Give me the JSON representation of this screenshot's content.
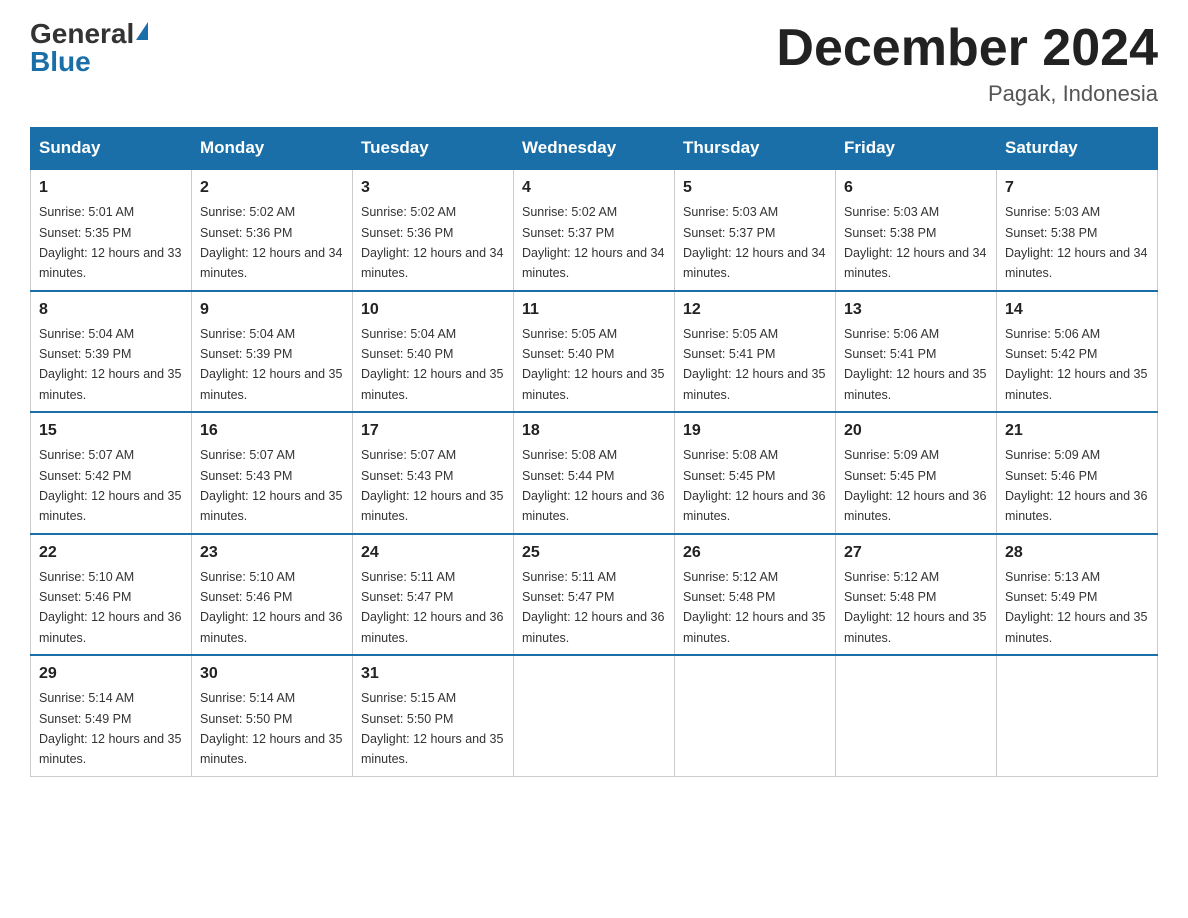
{
  "logo": {
    "general": "General",
    "blue": "Blue",
    "triangle": "▶"
  },
  "title": "December 2024",
  "location": "Pagak, Indonesia",
  "days_of_week": [
    "Sunday",
    "Monday",
    "Tuesday",
    "Wednesday",
    "Thursday",
    "Friday",
    "Saturday"
  ],
  "weeks": [
    [
      {
        "day": 1,
        "sunrise": "5:01 AM",
        "sunset": "5:35 PM",
        "daylight": "12 hours and 33 minutes."
      },
      {
        "day": 2,
        "sunrise": "5:02 AM",
        "sunset": "5:36 PM",
        "daylight": "12 hours and 34 minutes."
      },
      {
        "day": 3,
        "sunrise": "5:02 AM",
        "sunset": "5:36 PM",
        "daylight": "12 hours and 34 minutes."
      },
      {
        "day": 4,
        "sunrise": "5:02 AM",
        "sunset": "5:37 PM",
        "daylight": "12 hours and 34 minutes."
      },
      {
        "day": 5,
        "sunrise": "5:03 AM",
        "sunset": "5:37 PM",
        "daylight": "12 hours and 34 minutes."
      },
      {
        "day": 6,
        "sunrise": "5:03 AM",
        "sunset": "5:38 PM",
        "daylight": "12 hours and 34 minutes."
      },
      {
        "day": 7,
        "sunrise": "5:03 AM",
        "sunset": "5:38 PM",
        "daylight": "12 hours and 34 minutes."
      }
    ],
    [
      {
        "day": 8,
        "sunrise": "5:04 AM",
        "sunset": "5:39 PM",
        "daylight": "12 hours and 35 minutes."
      },
      {
        "day": 9,
        "sunrise": "5:04 AM",
        "sunset": "5:39 PM",
        "daylight": "12 hours and 35 minutes."
      },
      {
        "day": 10,
        "sunrise": "5:04 AM",
        "sunset": "5:40 PM",
        "daylight": "12 hours and 35 minutes."
      },
      {
        "day": 11,
        "sunrise": "5:05 AM",
        "sunset": "5:40 PM",
        "daylight": "12 hours and 35 minutes."
      },
      {
        "day": 12,
        "sunrise": "5:05 AM",
        "sunset": "5:41 PM",
        "daylight": "12 hours and 35 minutes."
      },
      {
        "day": 13,
        "sunrise": "5:06 AM",
        "sunset": "5:41 PM",
        "daylight": "12 hours and 35 minutes."
      },
      {
        "day": 14,
        "sunrise": "5:06 AM",
        "sunset": "5:42 PM",
        "daylight": "12 hours and 35 minutes."
      }
    ],
    [
      {
        "day": 15,
        "sunrise": "5:07 AM",
        "sunset": "5:42 PM",
        "daylight": "12 hours and 35 minutes."
      },
      {
        "day": 16,
        "sunrise": "5:07 AM",
        "sunset": "5:43 PM",
        "daylight": "12 hours and 35 minutes."
      },
      {
        "day": 17,
        "sunrise": "5:07 AM",
        "sunset": "5:43 PM",
        "daylight": "12 hours and 35 minutes."
      },
      {
        "day": 18,
        "sunrise": "5:08 AM",
        "sunset": "5:44 PM",
        "daylight": "12 hours and 36 minutes."
      },
      {
        "day": 19,
        "sunrise": "5:08 AM",
        "sunset": "5:45 PM",
        "daylight": "12 hours and 36 minutes."
      },
      {
        "day": 20,
        "sunrise": "5:09 AM",
        "sunset": "5:45 PM",
        "daylight": "12 hours and 36 minutes."
      },
      {
        "day": 21,
        "sunrise": "5:09 AM",
        "sunset": "5:46 PM",
        "daylight": "12 hours and 36 minutes."
      }
    ],
    [
      {
        "day": 22,
        "sunrise": "5:10 AM",
        "sunset": "5:46 PM",
        "daylight": "12 hours and 36 minutes."
      },
      {
        "day": 23,
        "sunrise": "5:10 AM",
        "sunset": "5:46 PM",
        "daylight": "12 hours and 36 minutes."
      },
      {
        "day": 24,
        "sunrise": "5:11 AM",
        "sunset": "5:47 PM",
        "daylight": "12 hours and 36 minutes."
      },
      {
        "day": 25,
        "sunrise": "5:11 AM",
        "sunset": "5:47 PM",
        "daylight": "12 hours and 36 minutes."
      },
      {
        "day": 26,
        "sunrise": "5:12 AM",
        "sunset": "5:48 PM",
        "daylight": "12 hours and 35 minutes."
      },
      {
        "day": 27,
        "sunrise": "5:12 AM",
        "sunset": "5:48 PM",
        "daylight": "12 hours and 35 minutes."
      },
      {
        "day": 28,
        "sunrise": "5:13 AM",
        "sunset": "5:49 PM",
        "daylight": "12 hours and 35 minutes."
      }
    ],
    [
      {
        "day": 29,
        "sunrise": "5:14 AM",
        "sunset": "5:49 PM",
        "daylight": "12 hours and 35 minutes."
      },
      {
        "day": 30,
        "sunrise": "5:14 AM",
        "sunset": "5:50 PM",
        "daylight": "12 hours and 35 minutes."
      },
      {
        "day": 31,
        "sunrise": "5:15 AM",
        "sunset": "5:50 PM",
        "daylight": "12 hours and 35 minutes."
      },
      null,
      null,
      null,
      null
    ]
  ]
}
